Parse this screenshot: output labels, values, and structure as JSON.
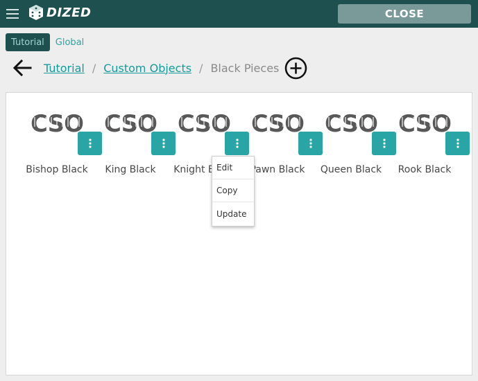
{
  "app": {
    "logo_text": "DIZED",
    "close_label": "CLOSE"
  },
  "tabs": [
    {
      "label": "Tutorial",
      "active": true
    },
    {
      "label": "Global",
      "active": false
    }
  ],
  "breadcrumb": {
    "items": [
      {
        "label": "Tutorial",
        "link": true
      },
      {
        "label": "Custom Objects",
        "link": true
      },
      {
        "label": "Black Pieces",
        "link": false
      }
    ],
    "separator": "/"
  },
  "objects": [
    {
      "thumb": "CSO",
      "name": "Bishop Black"
    },
    {
      "thumb": "CSO",
      "name": "King Black"
    },
    {
      "thumb": "CSO",
      "name": "Knight Black"
    },
    {
      "thumb": "CSO",
      "name": "Pawn Black"
    },
    {
      "thumb": "CSO",
      "name": "Queen Black"
    },
    {
      "thumb": "CSO",
      "name": "Rook Black"
    }
  ],
  "context_menu": {
    "open_on": "Knight Black",
    "items": [
      "Edit",
      "Copy",
      "Update"
    ]
  },
  "icons": {
    "menu": "hamburger-icon",
    "back": "arrow-left-icon",
    "add": "plus-circle-icon",
    "item_menu": "more-vertical-icon"
  },
  "colors": {
    "header": "#1f5050",
    "accent": "#2aa5a5",
    "close_button": "#7a9a9a"
  }
}
